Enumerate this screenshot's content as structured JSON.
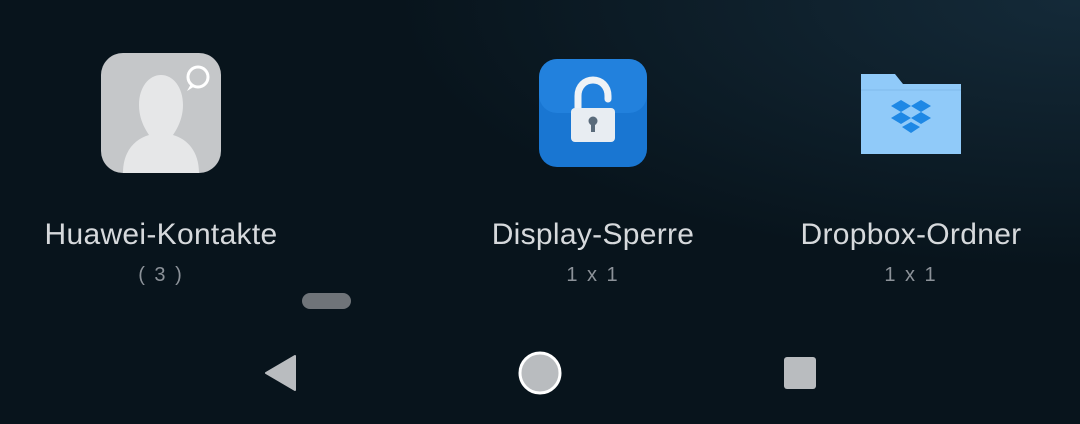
{
  "widgets": [
    {
      "label": "Huawei-Kontakte",
      "sub": "( 3 )",
      "icon": "contact-silhouette-icon"
    },
    {
      "label": "Display-Sperre",
      "sub": "1 x 1",
      "icon": "unlocked-padlock-icon"
    },
    {
      "label": "Dropbox-Ordner",
      "sub": "1 x 1",
      "icon": "dropbox-folder-icon"
    }
  ],
  "navbar": {
    "back": "back-triangle-icon",
    "home": "home-circle-icon",
    "recents": "recents-square-icon"
  },
  "colors": {
    "background": "#08141c",
    "label": "#d6d9dc",
    "sublabel": "#8c9299",
    "lock_blue": "#1976d2",
    "folder_blue": "#90caf9",
    "dropbox_blue": "#1e88e5",
    "nav_gray": "#b9bcbf"
  }
}
